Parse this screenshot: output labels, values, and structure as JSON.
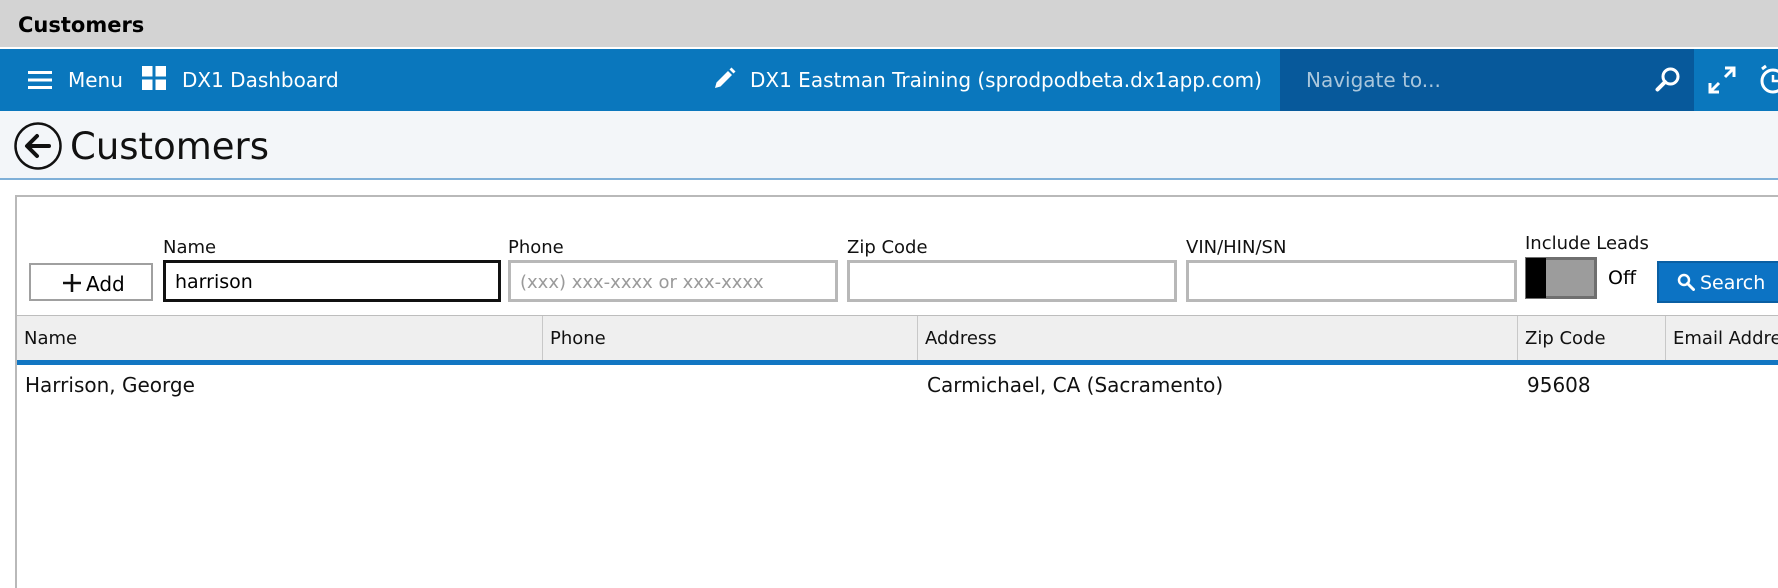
{
  "window": {
    "title": "Customers"
  },
  "nav": {
    "menu_label": "Menu",
    "dashboard_label": "DX1 Dashboard",
    "site_label": "DX1 Eastman Training (sprodpodbeta.dx1app.com)",
    "navigate_placeholder": "Navigate to..."
  },
  "page": {
    "title": "Customers"
  },
  "filters": {
    "add_label": "Add",
    "name": {
      "label": "Name",
      "value": "harrison"
    },
    "phone": {
      "label": "Phone",
      "placeholder": "(xxx) xxx-xxxx or xxx-xxxx"
    },
    "zip": {
      "label": "Zip Code",
      "value": ""
    },
    "vin": {
      "label": "VIN/HIN/SN",
      "value": ""
    },
    "include_leads": {
      "label": "Include Leads",
      "state": "Off"
    },
    "search_label": "Search"
  },
  "grid": {
    "columns": [
      "Name",
      "Phone",
      "Address",
      "Zip Code",
      "Email Addre"
    ],
    "rows": [
      {
        "name": "Harrison, George",
        "phone": "",
        "address": "Carmichael, CA (Sacramento)",
        "zip": "95608"
      }
    ]
  },
  "colors": {
    "nav_bg": "#0a77bd",
    "nav_search_bg": "#07599b",
    "accent": "#1276c2",
    "search_button": "#0c73c4"
  }
}
